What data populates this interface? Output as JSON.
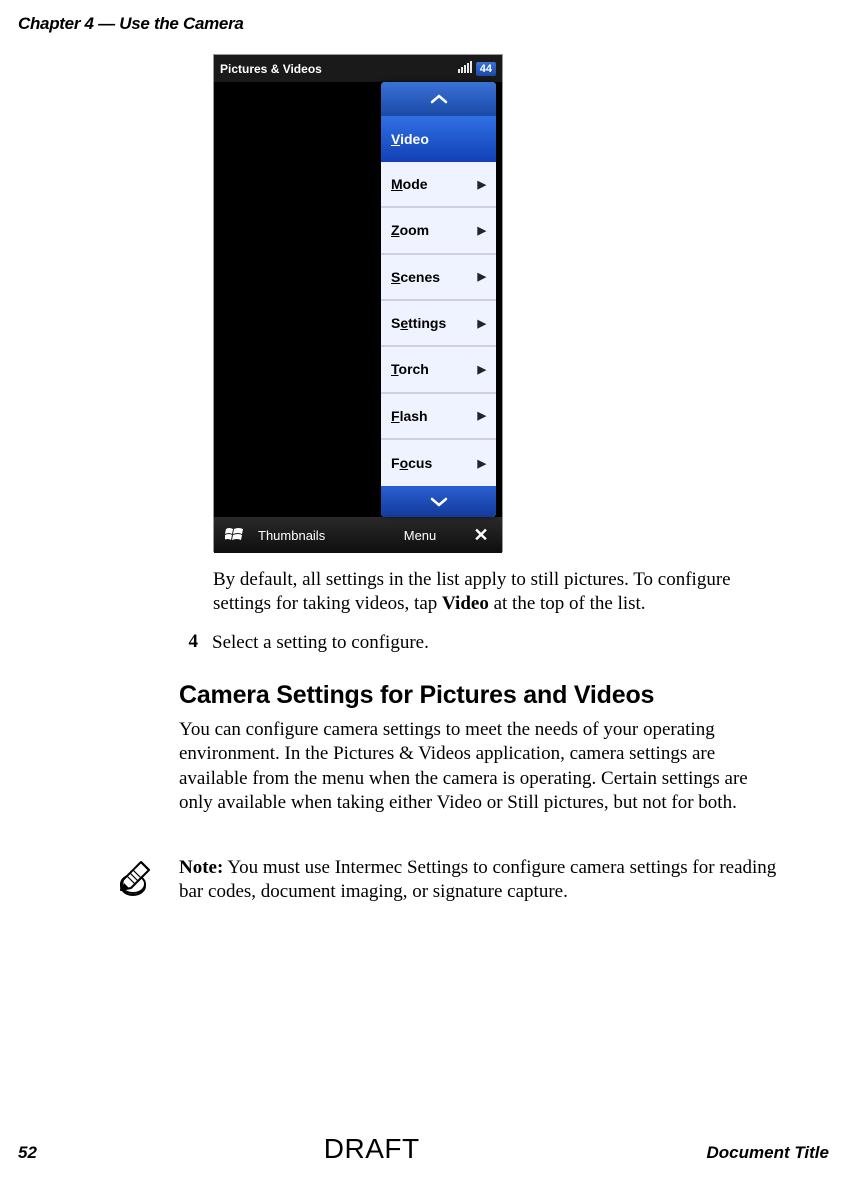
{
  "header": {
    "chapter": "Chapter 4 — Use the Camera"
  },
  "screenshot": {
    "topbar": {
      "title": "Pictures & Videos",
      "time": "44"
    },
    "menu": {
      "items": [
        {
          "label": "Video",
          "key": "V",
          "rest": "ideo",
          "selected": true,
          "arrow": false
        },
        {
          "label": "Mode",
          "key": "M",
          "rest": "ode",
          "selected": false,
          "arrow": true
        },
        {
          "label": "Zoom",
          "key": "Z",
          "rest": "oom",
          "selected": false,
          "arrow": true
        },
        {
          "label": "Scenes",
          "key": "S",
          "rest": "cenes",
          "selected": false,
          "arrow": true
        },
        {
          "label": "Settings",
          "key": "e",
          "pre": "S",
          "rest": "ttings",
          "selected": false,
          "arrow": true
        },
        {
          "label": "Torch",
          "key": "T",
          "rest": "orch",
          "selected": false,
          "arrow": true
        },
        {
          "label": "Flash",
          "key": "F",
          "rest": "lash",
          "selected": false,
          "arrow": true
        },
        {
          "label": "Focus",
          "key": "o",
          "pre": "F",
          "rest": "cus",
          "selected": false,
          "arrow": true
        }
      ]
    },
    "bottombar": {
      "thumbnails": "Thumbnails",
      "menu": "Menu",
      "close": "✕"
    }
  },
  "body": {
    "p1_a": "By default, all settings in the list apply to still pictures. To configure settings for taking videos, tap ",
    "p1_bold": "Video",
    "p1_b": " at the top of the list.",
    "step_num": "4",
    "step_text": "Select a setting to configure.",
    "h2": "Camera Settings for Pictures and Videos",
    "p2": "You can configure camera settings to meet the needs of your operating environment. In the Pictures & Videos application, camera settings are available from the menu when the camera is operating. Certain settings are only available when taking either Video or Still pictures, but not for both.",
    "note_bold": "Note:",
    "note_text": " You must use Intermec Settings to configure camera settings for reading bar codes, document imaging, or signature capture."
  },
  "footer": {
    "page": "52",
    "watermark": "DRAFT",
    "doctitle": "Document Title"
  }
}
